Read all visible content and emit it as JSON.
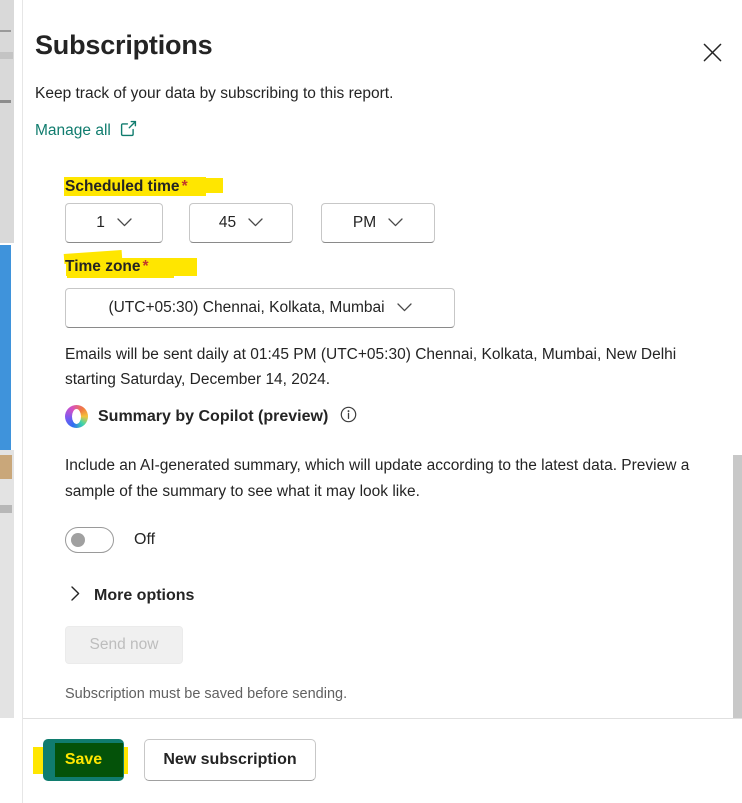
{
  "panel": {
    "title": "Subscriptions",
    "subtitle": "Keep track of your data by subscribing to this report.",
    "manage_all_label": "Manage all",
    "close_label": "Close"
  },
  "form": {
    "scheduled_time": {
      "label": "Scheduled time",
      "required_marker": "*",
      "hour": "1",
      "minute": "45",
      "meridiem": "PM"
    },
    "time_zone": {
      "label": "Time zone",
      "required_marker": "*",
      "value": "(UTC+05:30) Chennai, Kolkata, Mumbai"
    },
    "schedule_summary": "Emails will be sent daily at 01:45 PM (UTC+05:30) Chennai, Kolkata, Mumbai, New Delhi starting Saturday, December 14, 2024."
  },
  "copilot": {
    "title": "Summary by Copilot (preview)",
    "description": "Include an AI-generated summary, which will update according to the latest data. Preview a sample of the summary to see what it may look like.",
    "toggle_state": "Off"
  },
  "more_options": {
    "label": "More options"
  },
  "send": {
    "button_label": "Send now",
    "note": "Subscription must be saved before sending."
  },
  "footer": {
    "save_label": "Save",
    "new_subscription_label": "New subscription"
  },
  "colors": {
    "accent_teal": "#107c6e",
    "link_teal": "#107c6e",
    "highlight_yellow": "#ffe600",
    "required_red": "#c0392b",
    "text_primary": "#242424",
    "text_muted": "#616161",
    "background_blue_bar": "#3f93db"
  }
}
